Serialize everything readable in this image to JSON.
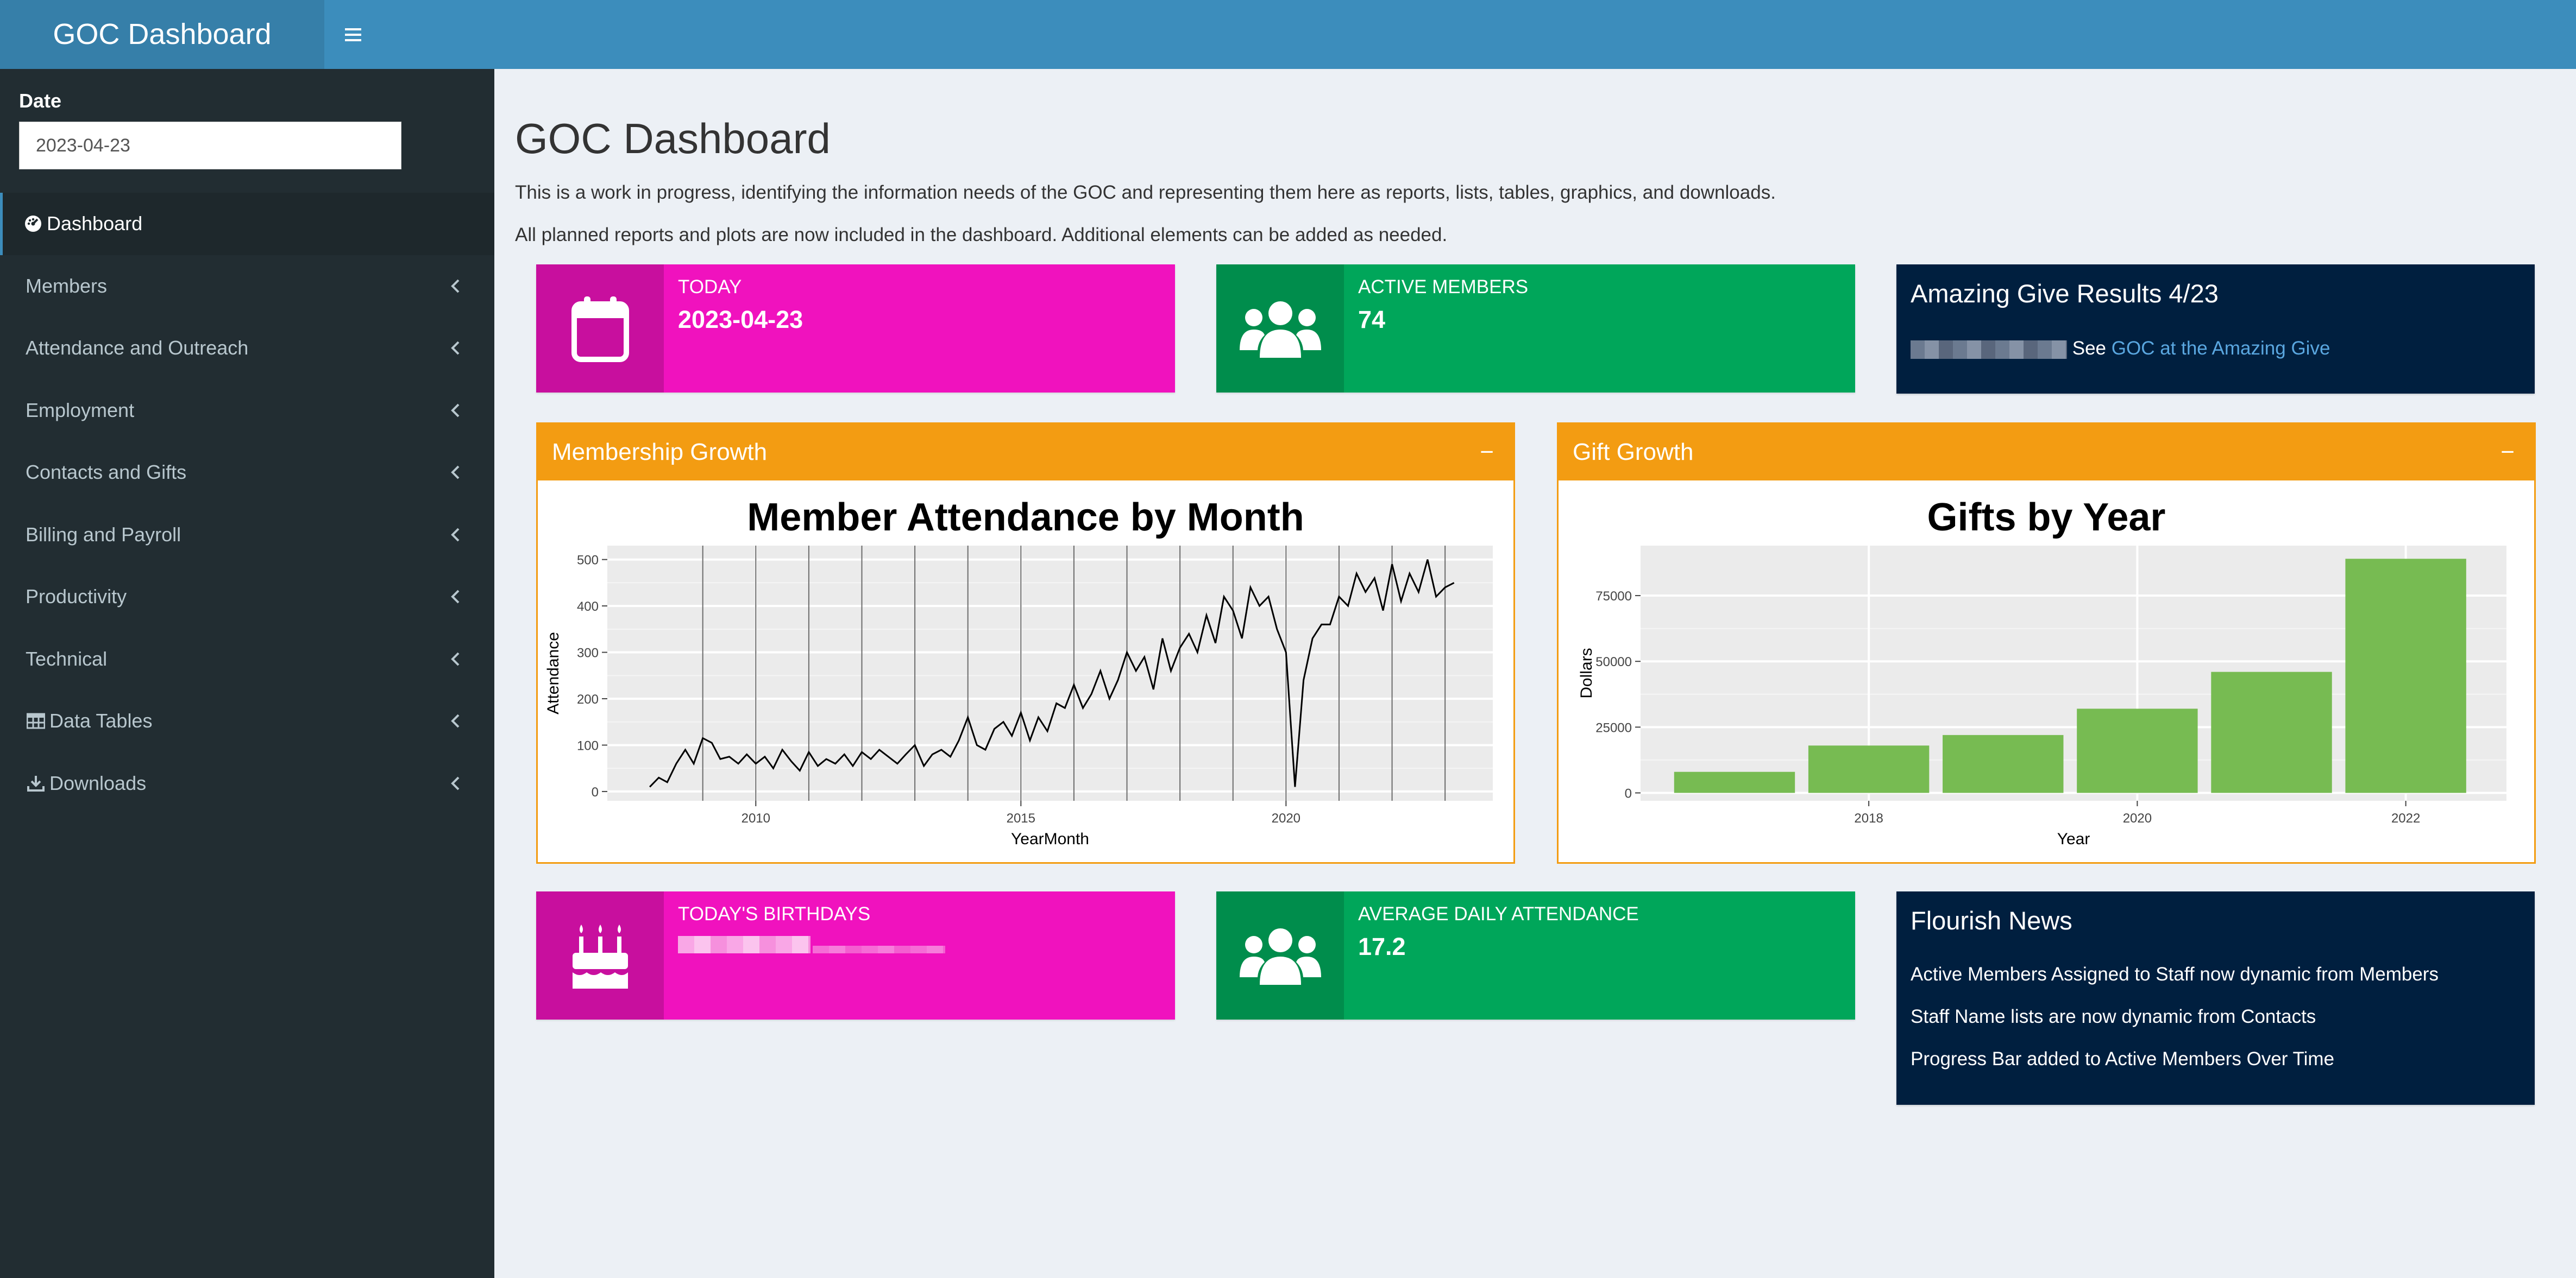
{
  "header": {
    "title": "GOC Dashboard",
    "menu_icon": "hamburger-icon"
  },
  "sidebar": {
    "date_label": "Date",
    "date_value": "2023-04-23",
    "items": [
      {
        "label": "Dashboard",
        "icon": "dashboard-icon",
        "active": true
      },
      {
        "label": "Members"
      },
      {
        "label": "Attendance and Outreach"
      },
      {
        "label": "Employment"
      },
      {
        "label": "Contacts and Gifts"
      },
      {
        "label": "Billing and Payroll"
      },
      {
        "label": "Productivity"
      },
      {
        "label": "Technical"
      },
      {
        "label": "Data Tables",
        "icon": "table-icon"
      },
      {
        "label": "Downloads",
        "icon": "download-icon"
      }
    ]
  },
  "main": {
    "title": "GOC Dashboard",
    "intro_1": "This is a work in progress, identifying the information needs of the GOC and representing them here as reports, lists, tables, graphics, and downloads.",
    "intro_2": "All planned reports and plots are now included in the dashboard. Additional elements can be added as needed."
  },
  "infoboxes": {
    "today": {
      "label": "TODAY",
      "value": "2023-04-23",
      "icon": "calendar-icon",
      "color": "#f012be"
    },
    "active_members": {
      "label": "ACTIVE MEMBERS",
      "value": "74",
      "icon": "users-icon",
      "color": "#00a65a"
    },
    "birthdays": {
      "label": "TODAY'S BIRTHDAYS",
      "icon": "birthday-cake-icon",
      "color": "#f012be"
    },
    "avg_attendance": {
      "label": "AVERAGE DAILY ATTENDANCE",
      "value": "17.2",
      "icon": "users-icon",
      "color": "#00a65a"
    }
  },
  "amazing_give": {
    "title": "Amazing Give Results 4/23",
    "see": "See",
    "link": "GOC at the Amazing Give"
  },
  "news": {
    "title": "Flourish News",
    "items": [
      "Active Members Assigned to Staff now dynamic from Members",
      "Staff Name lists are now dynamic from Contacts",
      "Progress Bar added to Active Members Over Time"
    ]
  },
  "panels": {
    "membership": {
      "title": "Membership Growth",
      "collapse": "−"
    },
    "gifts": {
      "title": "Gift Growth",
      "collapse": "−"
    }
  },
  "chart_data": [
    {
      "type": "line",
      "title": "Member Attendance by Month",
      "xlabel": "YearMonth",
      "ylabel": "Attendance",
      "xlim": [
        2007.2,
        2023.9
      ],
      "ylim": [
        -20,
        530
      ],
      "xticks": [
        2010,
        2015,
        2020
      ],
      "yticks": [
        0,
        100,
        200,
        300,
        400,
        500
      ],
      "vlines": [
        2009,
        2010,
        2011,
        2012,
        2013,
        2014,
        2015,
        2016,
        2017,
        2018,
        2019,
        2020,
        2021,
        2022,
        2023
      ],
      "x": [
        2008.0,
        2008.17,
        2008.33,
        2008.5,
        2008.67,
        2008.83,
        2009.0,
        2009.17,
        2009.33,
        2009.5,
        2009.67,
        2009.83,
        2010.0,
        2010.17,
        2010.33,
        2010.5,
        2010.67,
        2010.83,
        2011.0,
        2011.17,
        2011.33,
        2011.5,
        2011.67,
        2011.83,
        2012.0,
        2012.17,
        2012.33,
        2012.5,
        2012.67,
        2012.83,
        2013.0,
        2013.17,
        2013.33,
        2013.5,
        2013.67,
        2013.83,
        2014.0,
        2014.17,
        2014.33,
        2014.5,
        2014.67,
        2014.83,
        2015.0,
        2015.17,
        2015.33,
        2015.5,
        2015.67,
        2015.83,
        2016.0,
        2016.17,
        2016.33,
        2016.5,
        2016.67,
        2016.83,
        2017.0,
        2017.17,
        2017.33,
        2017.5,
        2017.67,
        2017.83,
        2018.0,
        2018.17,
        2018.33,
        2018.5,
        2018.67,
        2018.83,
        2019.0,
        2019.17,
        2019.33,
        2019.5,
        2019.67,
        2019.83,
        2020.0,
        2020.17,
        2020.33,
        2020.5,
        2020.67,
        2020.83,
        2021.0,
        2021.17,
        2021.33,
        2021.5,
        2021.67,
        2021.83,
        2022.0,
        2022.17,
        2022.33,
        2022.5,
        2022.67,
        2022.83,
        2023.0,
        2023.17
      ],
      "y": [
        10,
        30,
        20,
        60,
        90,
        60,
        115,
        105,
        70,
        75,
        60,
        80,
        60,
        75,
        50,
        90,
        65,
        45,
        85,
        55,
        70,
        60,
        80,
        55,
        85,
        70,
        90,
        75,
        60,
        80,
        100,
        55,
        80,
        90,
        75,
        110,
        160,
        100,
        90,
        135,
        150,
        120,
        170,
        110,
        160,
        130,
        190,
        180,
        230,
        180,
        210,
        260,
        200,
        240,
        300,
        260,
        290,
        220,
        330,
        260,
        310,
        340,
        300,
        380,
        320,
        420,
        390,
        330,
        440,
        400,
        420,
        350,
        300,
        10,
        240,
        330,
        360,
        360,
        420,
        400,
        470,
        430,
        460,
        390,
        490,
        410,
        470,
        430,
        500,
        420,
        440,
        450
      ],
      "line_color": "#000000",
      "grid": true
    },
    {
      "type": "bar",
      "title": "Gifts by Year",
      "xlabel": "Year",
      "ylabel": "Dollars",
      "x": [
        2017,
        2018,
        2019,
        2020,
        2021,
        2022
      ],
      "values": [
        8000,
        18000,
        22000,
        32000,
        46000,
        89000
      ],
      "xlim": [
        2016.3,
        2022.75
      ],
      "ylim": [
        -3000,
        94000
      ],
      "xticks": [
        2018,
        2020,
        2022
      ],
      "yticks": [
        0,
        25000,
        50000,
        75000
      ],
      "bar_color": "#77bb52",
      "grid": true
    }
  ]
}
